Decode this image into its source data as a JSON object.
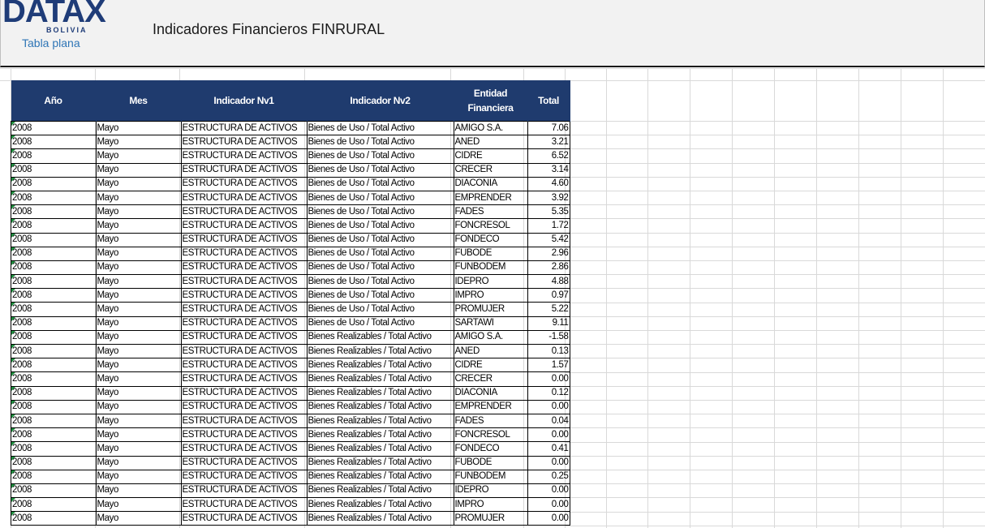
{
  "header": {
    "logo_text": "DATAX",
    "logo_sub": "BOLIVIA",
    "subtitle": "Tabla plana",
    "title": "Indicadores Financieros FINRURAL"
  },
  "table": {
    "columns": [
      "Año",
      "Mes",
      "Indicador Nv1",
      "Indicador Nv2",
      "Entidad Financiera",
      "Total"
    ],
    "rows": [
      [
        "2008",
        "Mayo",
        "ESTRUCTURA DE ACTIVOS",
        "Bienes de Uso / Total Activo",
        "AMIGO S.A.",
        "7.06"
      ],
      [
        "2008",
        "Mayo",
        "ESTRUCTURA DE ACTIVOS",
        "Bienes de Uso / Total Activo",
        "ANED",
        "3.21"
      ],
      [
        "2008",
        "Mayo",
        "ESTRUCTURA DE ACTIVOS",
        "Bienes de Uso / Total Activo",
        "CIDRE",
        "6.52"
      ],
      [
        "2008",
        "Mayo",
        "ESTRUCTURA DE ACTIVOS",
        "Bienes de Uso / Total Activo",
        "CRECER",
        "3.14"
      ],
      [
        "2008",
        "Mayo",
        "ESTRUCTURA DE ACTIVOS",
        "Bienes de Uso / Total Activo",
        "DIACONIA",
        "4.60"
      ],
      [
        "2008",
        "Mayo",
        "ESTRUCTURA DE ACTIVOS",
        "Bienes de Uso / Total Activo",
        "EMPRENDER",
        "3.92"
      ],
      [
        "2008",
        "Mayo",
        "ESTRUCTURA DE ACTIVOS",
        "Bienes de Uso / Total Activo",
        "FADES",
        "5.35"
      ],
      [
        "2008",
        "Mayo",
        "ESTRUCTURA DE ACTIVOS",
        "Bienes de Uso / Total Activo",
        "FONCRESOL",
        "1.72"
      ],
      [
        "2008",
        "Mayo",
        "ESTRUCTURA DE ACTIVOS",
        "Bienes de Uso / Total Activo",
        "FONDECO",
        "5.42"
      ],
      [
        "2008",
        "Mayo",
        "ESTRUCTURA DE ACTIVOS",
        "Bienes de Uso / Total Activo",
        "FUBODE",
        "2.96"
      ],
      [
        "2008",
        "Mayo",
        "ESTRUCTURA DE ACTIVOS",
        "Bienes de Uso / Total Activo",
        "FUNBODEM",
        "2.86"
      ],
      [
        "2008",
        "Mayo",
        "ESTRUCTURA DE ACTIVOS",
        "Bienes de Uso / Total Activo",
        "IDEPRO",
        "4.88"
      ],
      [
        "2008",
        "Mayo",
        "ESTRUCTURA DE ACTIVOS",
        "Bienes de Uso / Total Activo",
        "IMPRO",
        "0.97"
      ],
      [
        "2008",
        "Mayo",
        "ESTRUCTURA DE ACTIVOS",
        "Bienes de Uso / Total Activo",
        "PROMUJER",
        "5.22"
      ],
      [
        "2008",
        "Mayo",
        "ESTRUCTURA DE ACTIVOS",
        "Bienes de Uso / Total Activo",
        "SARTAWI",
        "9.11"
      ],
      [
        "2008",
        "Mayo",
        "ESTRUCTURA DE ACTIVOS",
        "Bienes Realizables / Total Activo",
        "AMIGO S.A.",
        "-1.58"
      ],
      [
        "2008",
        "Mayo",
        "ESTRUCTURA DE ACTIVOS",
        "Bienes Realizables / Total Activo",
        "ANED",
        "0.13"
      ],
      [
        "2008",
        "Mayo",
        "ESTRUCTURA DE ACTIVOS",
        "Bienes Realizables / Total Activo",
        "CIDRE",
        "1.57"
      ],
      [
        "2008",
        "Mayo",
        "ESTRUCTURA DE ACTIVOS",
        "Bienes Realizables / Total Activo",
        "CRECER",
        "0.00"
      ],
      [
        "2008",
        "Mayo",
        "ESTRUCTURA DE ACTIVOS",
        "Bienes Realizables / Total Activo",
        "DIACONIA",
        "0.12"
      ],
      [
        "2008",
        "Mayo",
        "ESTRUCTURA DE ACTIVOS",
        "Bienes Realizables / Total Activo",
        "EMPRENDER",
        "0.00"
      ],
      [
        "2008",
        "Mayo",
        "ESTRUCTURA DE ACTIVOS",
        "Bienes Realizables / Total Activo",
        "FADES",
        "0.04"
      ],
      [
        "2008",
        "Mayo",
        "ESTRUCTURA DE ACTIVOS",
        "Bienes Realizables / Total Activo",
        "FONCRESOL",
        "0.00"
      ],
      [
        "2008",
        "Mayo",
        "ESTRUCTURA DE ACTIVOS",
        "Bienes Realizables / Total Activo",
        "FONDECO",
        "0.41"
      ],
      [
        "2008",
        "Mayo",
        "ESTRUCTURA DE ACTIVOS",
        "Bienes Realizables / Total Activo",
        "FUBODE",
        "0.00"
      ],
      [
        "2008",
        "Mayo",
        "ESTRUCTURA DE ACTIVOS",
        "Bienes Realizables / Total Activo",
        "FUNBODEM",
        "0.25"
      ],
      [
        "2008",
        "Mayo",
        "ESTRUCTURA DE ACTIVOS",
        "Bienes Realizables / Total Activo",
        "IDEPRO",
        "0.00"
      ],
      [
        "2008",
        "Mayo",
        "ESTRUCTURA DE ACTIVOS",
        "Bienes Realizables / Total Activo",
        "IMPRO",
        "0.00"
      ],
      [
        "2008",
        "Mayo",
        "ESTRUCTURA DE ACTIVOS",
        "Bienes Realizables / Total Activo",
        "PROMUJER",
        "0.00"
      ]
    ]
  },
  "colors": {
    "header_fill": "#1f3b6e",
    "brand": "#1f3c78",
    "link": "#2e75b6",
    "error_marker": "#1e8e3e"
  }
}
